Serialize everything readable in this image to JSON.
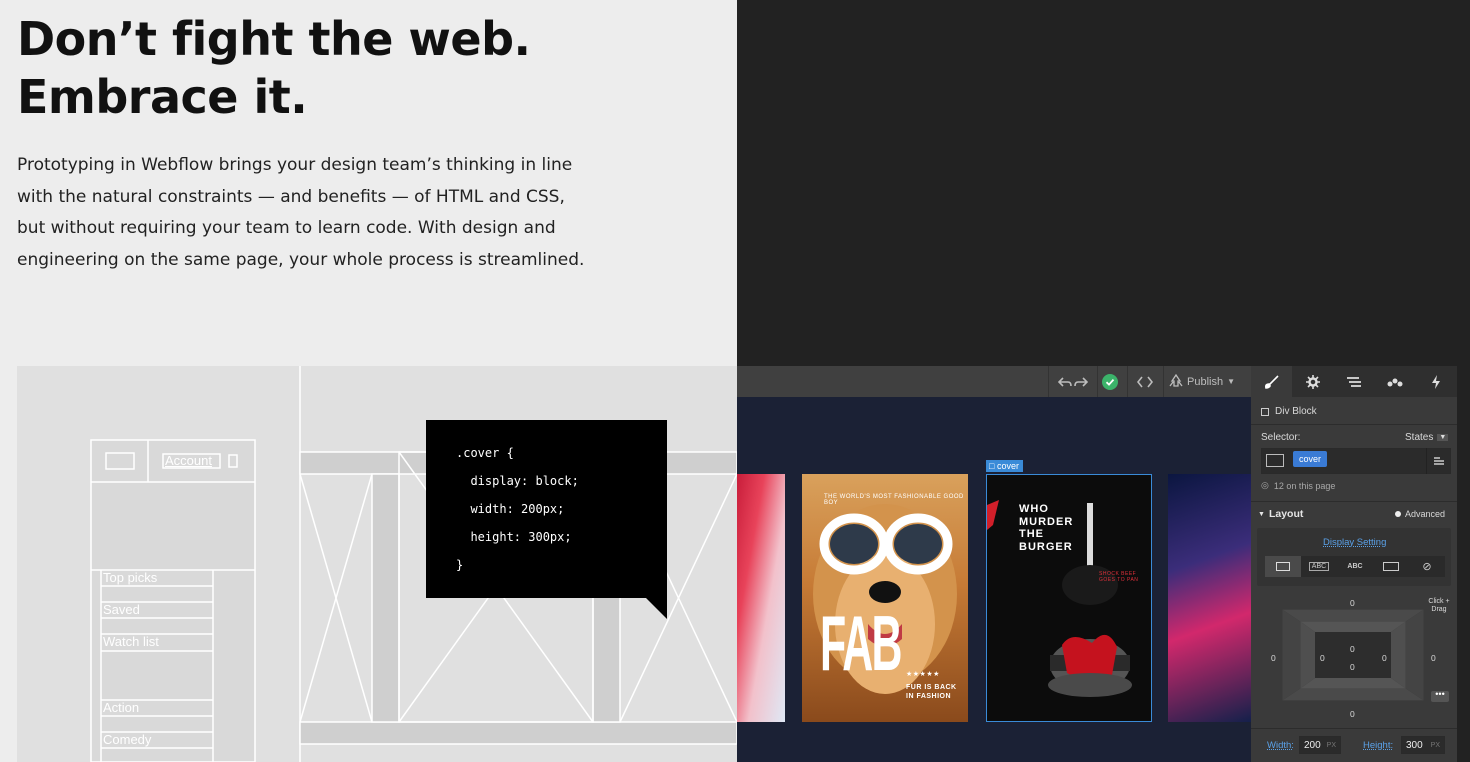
{
  "hero": {
    "headline_line1": "Don’t fight the web.",
    "headline_line2": "Embrace it.",
    "body_lines": [
      "Prototyping in Webflow brings your design team’s thinking in line",
      "with the natural constraints — and benefits — of HTML and CSS,",
      "but without requiring your team to learn code. With design and",
      "engineering on the same page, your whole process is streamlined."
    ]
  },
  "wireframe": {
    "account_label": "Account",
    "menu_items": [
      "Top picks",
      "Saved",
      "Watch list",
      "Action",
      "Comedy"
    ]
  },
  "code": {
    "lines": [
      ".cover {",
      "  display: block;",
      "  width: 200px;",
      "  height: 300px;",
      "}"
    ]
  },
  "designer": {
    "toolbar": {
      "publish_label": "Publish",
      "icons": [
        "undo-icon",
        "redo-icon",
        "check-icon",
        "code-icon",
        "publish-icon",
        "chevron-down-icon"
      ]
    },
    "panel": {
      "tab_icons": [
        "brush-icon",
        "gear-icon",
        "navigator-icon",
        "drops-icon",
        "lightning-icon"
      ],
      "element_label": "Div Block",
      "selector_label": "Selector:",
      "states_label": "States",
      "class_chip": "cover",
      "count_label": "12 on this page",
      "layout_label": "Layout",
      "advanced_label": "Advanced",
      "display_setting_label": "Display Setting",
      "display_options": [
        "",
        "ABC",
        "ABC",
        "",
        ""
      ],
      "margin_top": "0",
      "padding_top": "0",
      "margin_left": "0",
      "padding_left": "0",
      "padding_right": "0",
      "margin_right": "0",
      "padding_bottom": "0",
      "margin_bottom": "0",
      "click_drag_hint": "Click + Drag",
      "width_label": "Width:",
      "width_value": "200",
      "width_unit": "PX",
      "height_label": "Height:",
      "height_value": "300",
      "height_unit": "PX"
    },
    "cover_tag": "cover",
    "cards": {
      "dog_tagline": "THE WORLD'S MOST FASHIONABLE GOOD BOY",
      "dog_title": "FAB",
      "dog_stars": "★★★★★",
      "dog_sub1": "FUR IS BACK",
      "dog_sub2": "IN FASHION",
      "burger_title_lines": [
        "WHO",
        "MURDER",
        "THE",
        "BURGER"
      ],
      "burger_side_text": "SHOCK BEEF GOES TO PAN"
    }
  }
}
